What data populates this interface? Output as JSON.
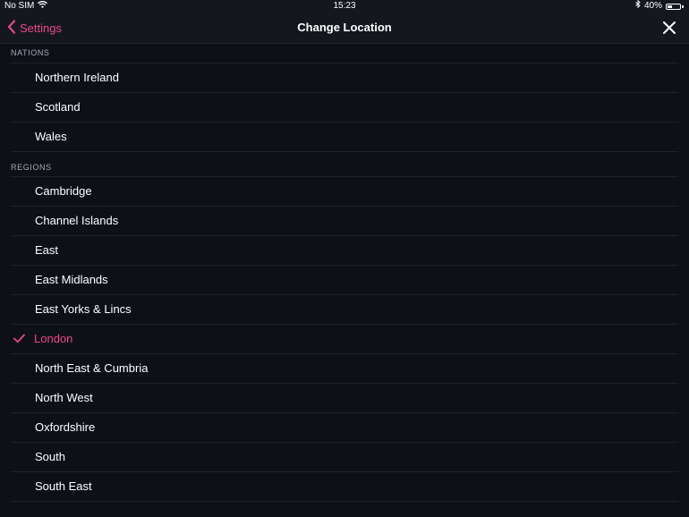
{
  "status": {
    "carrier": "No SIM",
    "time": "15:23",
    "battery": "40%",
    "battery_level": 0.4
  },
  "nav": {
    "back_label": "Settings",
    "title": "Change Location"
  },
  "sections": {
    "nations": {
      "header": "NATIONS",
      "items": [
        "Northern Ireland",
        "Scotland",
        "Wales"
      ]
    },
    "regions": {
      "header": "REGIONS",
      "items": [
        "Cambridge",
        "Channel Islands",
        "East",
        "East Midlands",
        "East Yorks & Lincs",
        "London",
        "North East & Cumbria",
        "North West",
        "Oxfordshire",
        "South",
        "South East"
      ]
    }
  },
  "selected_region": "London",
  "colors": {
    "accent": "#e8488a",
    "background": "#0e1018",
    "navbar": "#15171f"
  }
}
